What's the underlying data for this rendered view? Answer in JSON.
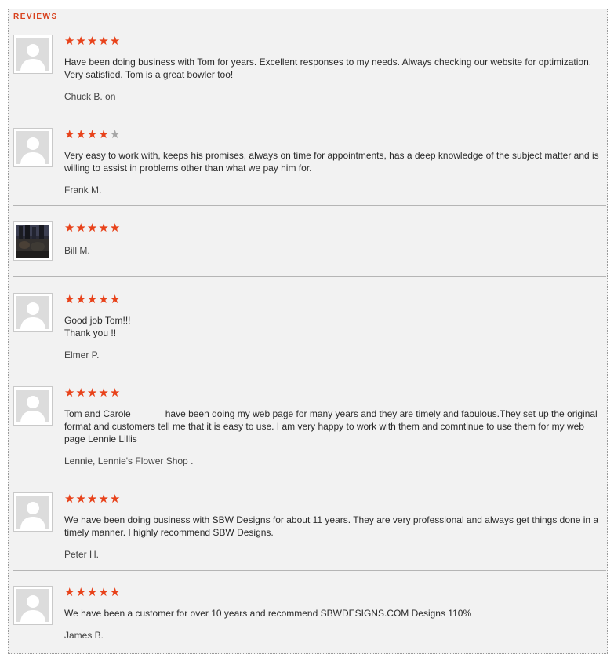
{
  "section": {
    "title": "REVIEWS"
  },
  "colors": {
    "star_filled": "#e8421a",
    "star_empty": "#a6a6a6",
    "heading": "#d8401c"
  },
  "reviews": [
    {
      "rating": 5,
      "max_rating": 5,
      "avatar": "default-avatar-icon",
      "text": "Have been doing business with Tom for years. Excellent responses to my needs. Always checking our website for optimization. Very satisfied. Tom is a great bowler too!",
      "author": "Chuck B. on"
    },
    {
      "rating": 4,
      "max_rating": 5,
      "avatar": "default-avatar-icon",
      "text": "Very easy to work with, keeps his promises, always on time for appointments, has a deep knowledge of the subject matter and is willing to assist in problems other than what we pay him for.",
      "author": "Frank M."
    },
    {
      "rating": 5,
      "max_rating": 5,
      "avatar": "photo-avatar",
      "text": "",
      "author": "Bill M."
    },
    {
      "rating": 5,
      "max_rating": 5,
      "avatar": "default-avatar-icon",
      "text_line1": "Good job Tom!!!",
      "text_line2": "Thank you !!",
      "author": "Elmer P."
    },
    {
      "rating": 5,
      "max_rating": 5,
      "avatar": "default-avatar-icon",
      "text_part1": "Tom and Carole",
      "text_part2": "have been doing my web page for many years and they are timely and fabulous.They set up the original format and customers tell me that it is easy to use. I am very happy to work with them and comntinue to use them for my web page Lennie Lillis",
      "author": "Lennie, Lennie's Flower Shop ."
    },
    {
      "rating": 5,
      "max_rating": 5,
      "avatar": "default-avatar-icon",
      "text": "We have been doing business with SBW Designs for about 11 years. They are very professional and always get things done in a timely manner. I highly recommend SBW Designs.",
      "author": "Peter H."
    },
    {
      "rating": 5,
      "max_rating": 5,
      "avatar": "default-avatar-icon",
      "text": "We have been a customer for over 10 years and recommend SBWDESIGNS.COM Designs 110%",
      "author": "James B."
    }
  ]
}
